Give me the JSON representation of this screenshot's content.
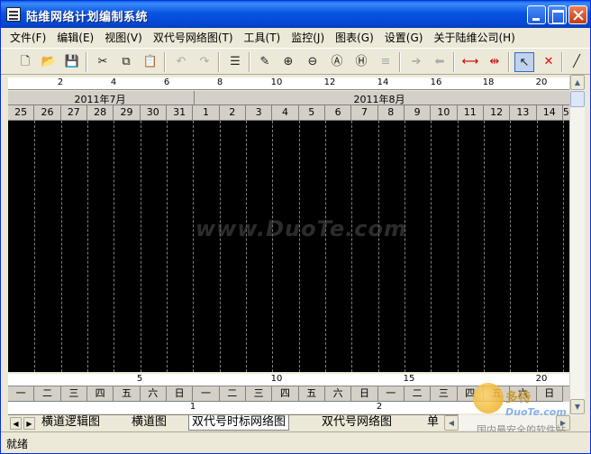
{
  "window": {
    "title": "陆维网络计划编制系统"
  },
  "menu": [
    "文件(F)",
    "编辑(E)",
    "视图(V)",
    "双代号网络图(T)",
    "工具(T)",
    "监控(J)",
    "图表(G)",
    "设置(G)",
    "关于陆维公司(H)"
  ],
  "toolbar": {
    "icons": [
      "new-icon",
      "open-icon",
      "save-icon",
      "cut-icon",
      "copy-icon",
      "paste-icon",
      "undo-icon",
      "redo-icon",
      "list-icon",
      "edit-icon",
      "zoom-in-icon",
      "zoom-out-icon",
      "zoom-fit-icon",
      "zoom-h-icon",
      "align-icon",
      "arrow-right-icon",
      "arrow-left-icon",
      "expand-icon",
      "collapse-icon",
      "pointer-icon",
      "delete-icon",
      "line-icon"
    ]
  },
  "ruler_top": [
    "2",
    "4",
    "6",
    "8",
    "10",
    "12",
    "14",
    "16",
    "18",
    "20"
  ],
  "months": [
    "2011年7月",
    "2011年8月"
  ],
  "days": [
    "25",
    "26",
    "27",
    "28",
    "29",
    "30",
    "31",
    "1",
    "2",
    "3",
    "4",
    "5",
    "6",
    "7",
    "8",
    "9",
    "10",
    "11",
    "12",
    "13",
    "14",
    "5"
  ],
  "ruler_bottom": [
    "5",
    "10",
    "15",
    "20"
  ],
  "weekdays": [
    "一",
    "二",
    "三",
    "四",
    "五",
    "六",
    "日",
    "一",
    "二",
    "三",
    "四",
    "五",
    "六",
    "日",
    "一",
    "二",
    "三",
    "四",
    "五",
    "六",
    "日"
  ],
  "ruler_bottom2": [
    "1",
    "2"
  ],
  "watermark": "www.DuoTe.com",
  "tabs": [
    "横道逻辑图",
    "横道图",
    "双代号时标网络图",
    "双代号网络图",
    "单"
  ],
  "active_tab": "双代号时标网络图",
  "status": "就绪",
  "corner_logo": {
    "brand": "多特",
    "brand_sub": "DuoTe.com",
    "tagline": "国内最安全的软件站"
  }
}
